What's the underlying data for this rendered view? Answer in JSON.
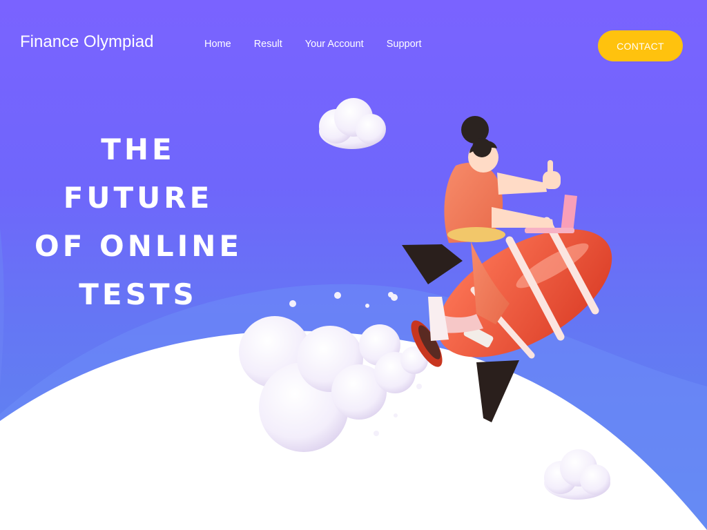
{
  "header": {
    "brand": "Finance Olympiad",
    "nav": [
      "Home",
      "Result",
      "Your Account",
      "Support"
    ],
    "contact_label": "CONTACT"
  },
  "hero": {
    "lines": [
      "THE",
      "FUTURE",
      "OF ONLINE",
      "TESTS"
    ]
  },
  "colors": {
    "background_top": "#7a63ff",
    "background_bottom": "#5c8aee",
    "button": "#ffc20e",
    "rocket": "#f0553a",
    "shirt": "#f27a5e"
  }
}
